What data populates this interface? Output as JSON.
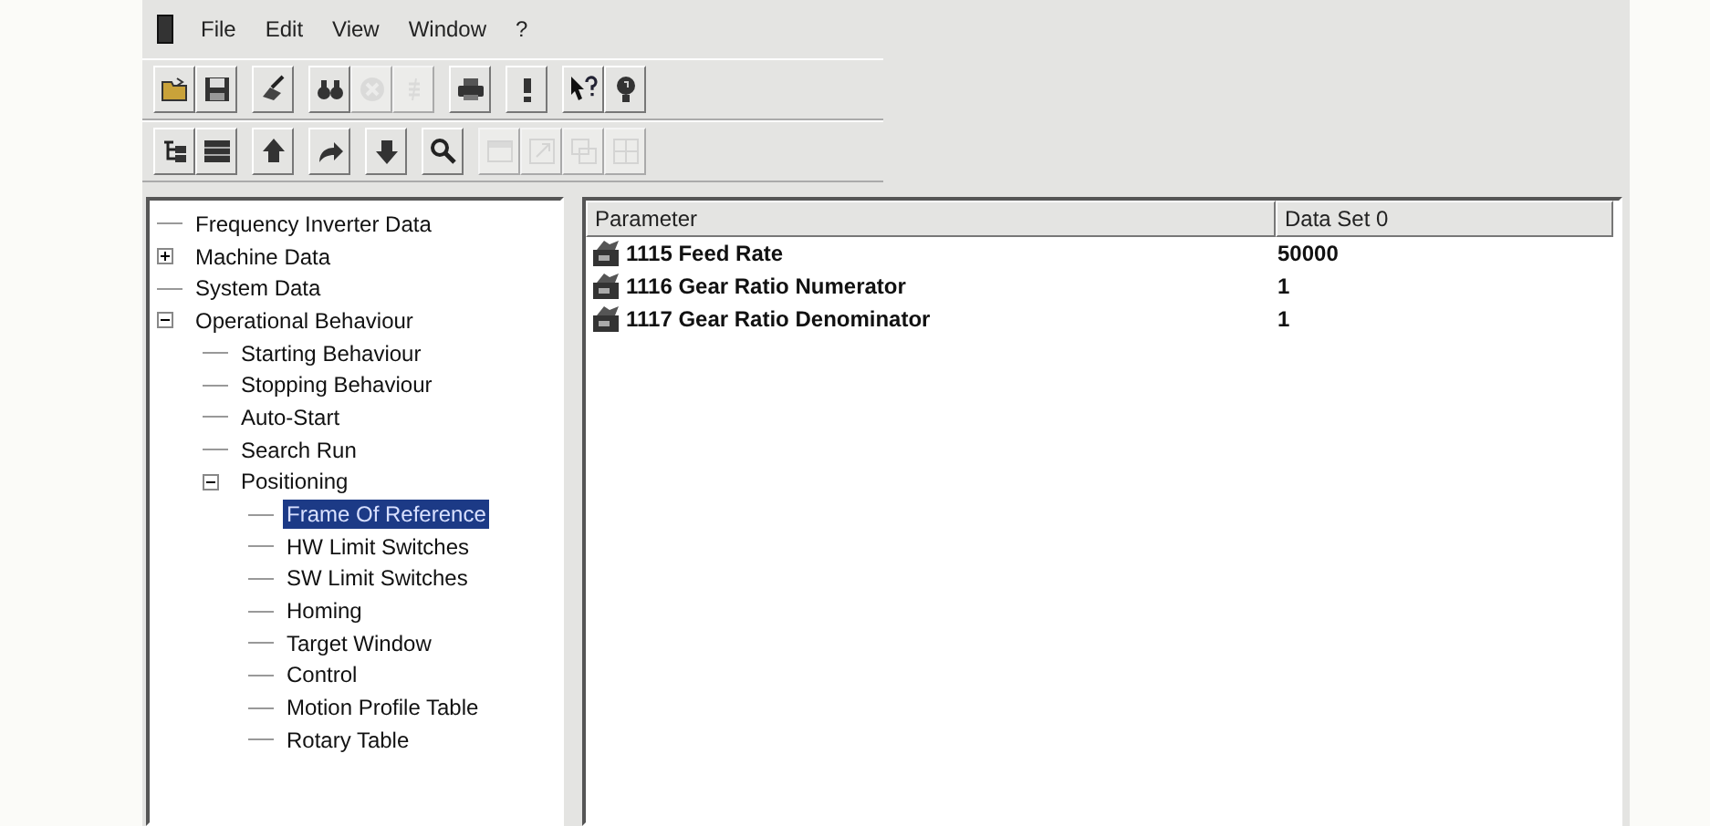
{
  "menu": [
    "File",
    "Edit",
    "View",
    "Window",
    "?"
  ],
  "toolbars": [
    {
      "groups": [
        {
          "buttons": [
            {
              "kind": "open",
              "disabled": false
            },
            {
              "kind": "save",
              "disabled": false
            }
          ]
        },
        {
          "buttons": [
            {
              "kind": "edit",
              "disabled": false
            }
          ]
        },
        {
          "buttons": [
            {
              "kind": "find",
              "disabled": false
            },
            {
              "kind": "cancel",
              "disabled": true
            },
            {
              "kind": "compare",
              "disabled": true
            }
          ]
        },
        {
          "buttons": [
            {
              "kind": "print",
              "disabled": false
            }
          ]
        },
        {
          "buttons": [
            {
              "kind": "bar",
              "disabled": false
            }
          ]
        },
        {
          "buttons": [
            {
              "kind": "whatsthis",
              "disabled": false
            },
            {
              "kind": "hint",
              "disabled": false
            }
          ]
        }
      ]
    },
    {
      "groups": [
        {
          "buttons": [
            {
              "kind": "tree",
              "disabled": false
            },
            {
              "kind": "list",
              "disabled": false
            }
          ]
        },
        {
          "buttons": [
            {
              "kind": "up",
              "disabled": false
            }
          ]
        },
        {
          "buttons": [
            {
              "kind": "redo",
              "disabled": false
            }
          ]
        },
        {
          "buttons": [
            {
              "kind": "down",
              "disabled": false
            }
          ]
        },
        {
          "buttons": [
            {
              "kind": "search",
              "disabled": false
            }
          ]
        },
        {
          "buttons": [
            {
              "kind": "window",
              "disabled": true
            },
            {
              "kind": "resize",
              "disabled": true
            },
            {
              "kind": "cascade",
              "disabled": true
            },
            {
              "kind": "grid",
              "disabled": true
            }
          ]
        }
      ]
    }
  ],
  "tree": [
    {
      "label": "Frequency Inverter Data",
      "selected": false
    },
    {
      "label": "Machine Data",
      "selected": false,
      "expanded": false
    },
    {
      "label": "System Data",
      "selected": false
    },
    {
      "label": "Operational Behaviour",
      "selected": false,
      "expanded": true,
      "children": [
        {
          "label": "Starting Behaviour",
          "selected": false
        },
        {
          "label": "Stopping Behaviour",
          "selected": false
        },
        {
          "label": "Auto-Start",
          "selected": false
        },
        {
          "label": "Search Run",
          "selected": false
        },
        {
          "label": "Positioning",
          "selected": false,
          "expanded": true,
          "children": [
            {
              "label": "Frame Of Reference",
              "selected": true
            },
            {
              "label": "HW Limit Switches",
              "selected": false
            },
            {
              "label": "SW Limit Switches",
              "selected": false
            },
            {
              "label": "Homing",
              "selected": false
            },
            {
              "label": "Target Window",
              "selected": false
            },
            {
              "label": "Control",
              "selected": false
            },
            {
              "label": "Motion Profile Table",
              "selected": false
            },
            {
              "label": "Rotary Table",
              "selected": false
            }
          ]
        }
      ]
    }
  ],
  "table": {
    "columns": [
      "Parameter",
      "Data Set 0"
    ],
    "rows": [
      {
        "parameter": "1115 Feed Rate",
        "value": "50000"
      },
      {
        "parameter": "1116 Gear Ratio Numerator",
        "value": "1"
      },
      {
        "parameter": "1117 Gear Ratio Denominator",
        "value": "1"
      }
    ]
  }
}
